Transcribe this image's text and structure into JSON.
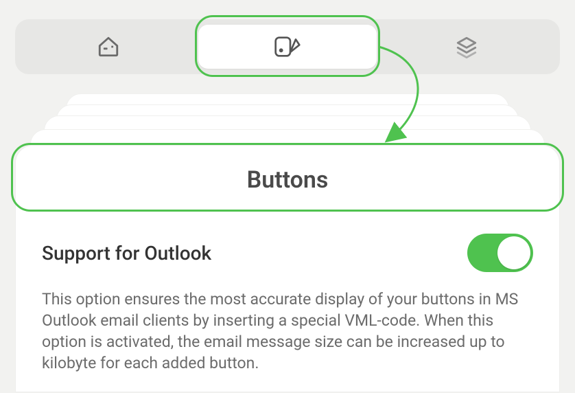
{
  "tabs": {
    "left_icon": "home-icon",
    "middle_icon": "design-icon",
    "right_icon": "layers-icon",
    "active_index": 1
  },
  "panel": {
    "title": "Buttons"
  },
  "setting": {
    "title": "Support for Outlook",
    "description": "This option ensures the most accurate display of your buttons in MS Outlook email clients by inserting a special VML-code. When this option is activated, the email message size can be increased up to kilobyte for each added button.",
    "enabled": true
  },
  "colors": {
    "accent": "#4fc24f"
  }
}
